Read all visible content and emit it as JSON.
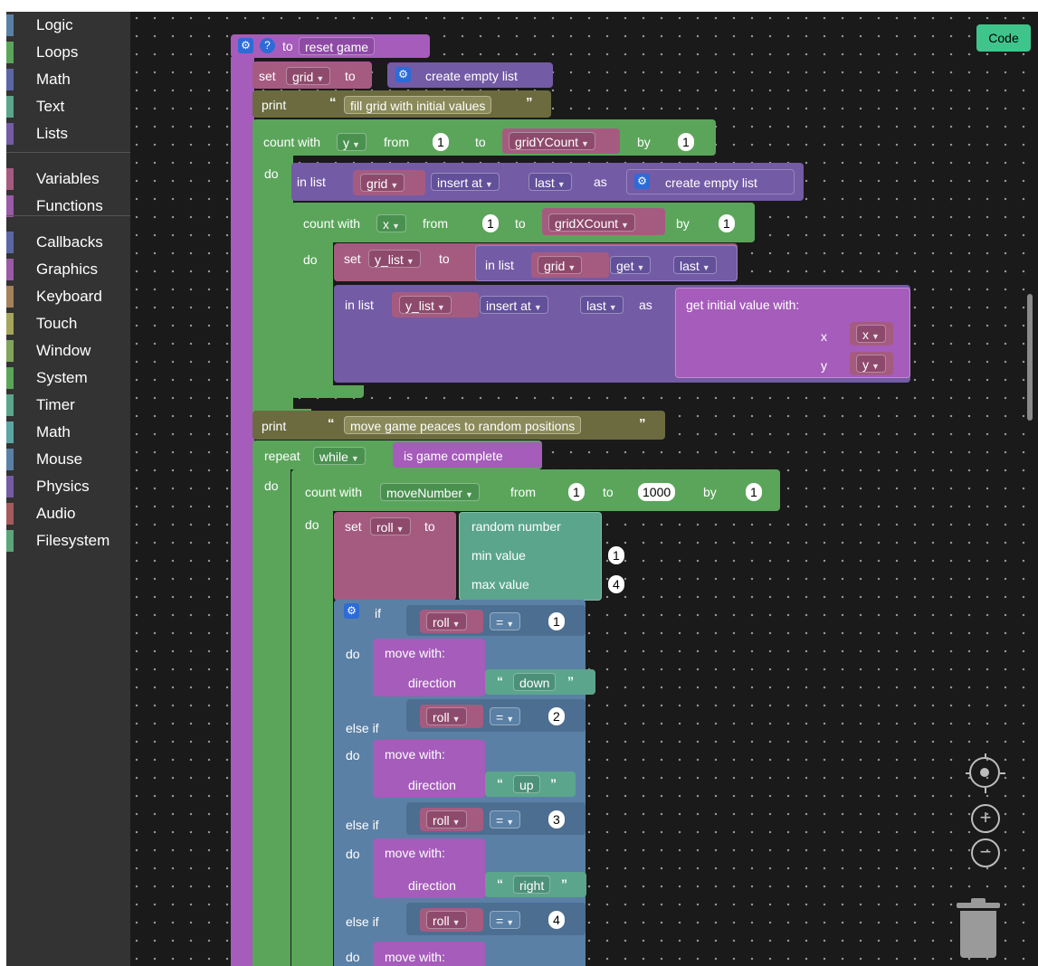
{
  "toolbox": {
    "categories": [
      {
        "label": "Logic",
        "color": "#5b80a5"
      },
      {
        "label": "Loops",
        "color": "#5ba55b"
      },
      {
        "label": "Math",
        "color": "#5b67a5"
      },
      {
        "label": "Text",
        "color": "#5ba58c"
      },
      {
        "label": "Lists",
        "color": "#745ba5"
      },
      {
        "label": "Variables",
        "color": "#a55b80"
      },
      {
        "label": "Functions",
        "color": "#995ba5"
      },
      {
        "label": "Callbacks",
        "color": "#5b67a5"
      },
      {
        "label": "Graphics",
        "color": "#995ba5"
      },
      {
        "label": "Keyboard",
        "color": "#a5805b"
      },
      {
        "label": "Touch",
        "color": "#a5a55b"
      },
      {
        "label": "Window",
        "color": "#80a55b"
      },
      {
        "label": "System",
        "color": "#5ba55b"
      },
      {
        "label": "Timer",
        "color": "#5ba58c"
      },
      {
        "label": "Math",
        "color": "#5ba5a5"
      },
      {
        "label": "Mouse",
        "color": "#5b80a5"
      },
      {
        "label": "Physics",
        "color": "#745ba5"
      },
      {
        "label": "Audio",
        "color": "#a55b5b"
      },
      {
        "label": "Filesystem",
        "color": "#5ba57a"
      }
    ]
  },
  "header": {
    "code_button": "Code"
  },
  "blocks": {
    "to": "to",
    "func_name": "reset game",
    "set": "set",
    "to_kw": "to",
    "grid": "grid",
    "create_empty_list": "create empty list",
    "print": "print",
    "str1": "fill grid with initial values",
    "count_with": "count with",
    "var_y": "y",
    "from": "from",
    "one": "1",
    "grid_y_count": "gridYCount",
    "by": "by",
    "do": "do",
    "in_list": "in list",
    "insert_at": "insert at",
    "last": "last",
    "as": "as",
    "var_x": "x",
    "grid_x_count": "gridXCount",
    "y_list": "y_list",
    "get": "get",
    "get_initial_value": "get initial value",
    "with": "with:",
    "x_label": "x",
    "y_label": "y",
    "str2": "move game peaces to random positions",
    "repeat": "repeat",
    "while": "while",
    "is_game_complete": "is game complete",
    "move_number": "moveNumber",
    "thousand": "1000",
    "roll": "roll",
    "random_number": "random number",
    "min_value": "min value",
    "max_value": "max value",
    "four": "4",
    "if": "if",
    "eq": "=",
    "else_if": "else if",
    "move": "move",
    "direction": "direction",
    "down": "down",
    "up": "up",
    "right": "right",
    "two": "2",
    "three": "3"
  }
}
